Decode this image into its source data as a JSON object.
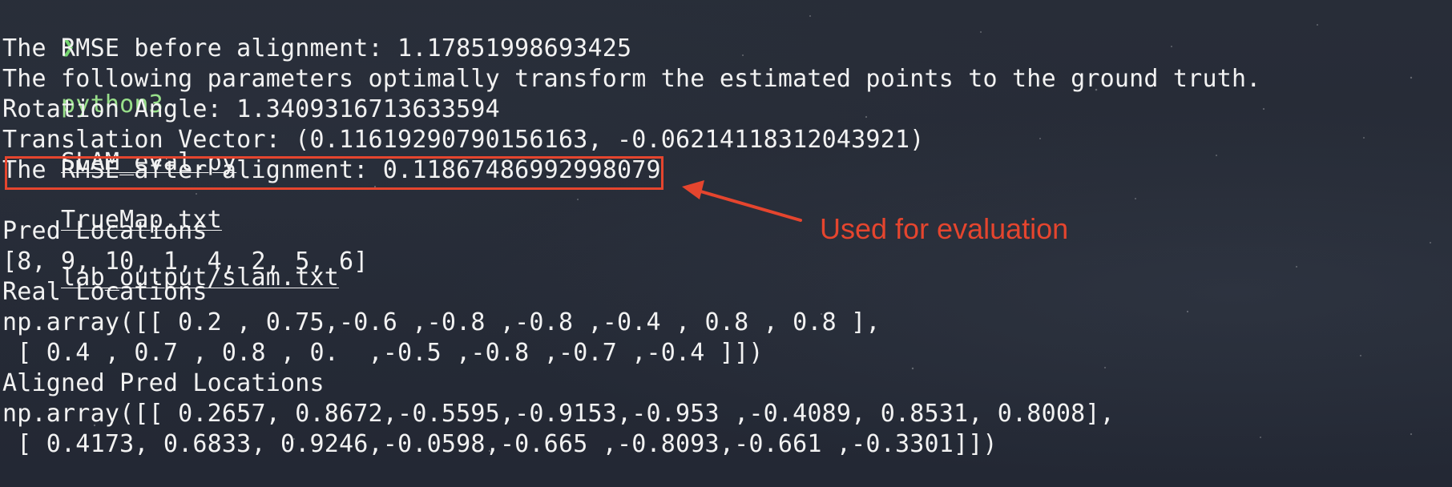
{
  "terminal": {
    "prompt": {
      "symbol": "❯",
      "command": "python3",
      "args": [
        "SLAM_eval.py",
        "TrueMap.txt",
        "lab_output/slam.txt"
      ]
    },
    "lines": [
      "The RMSE before alignment: 1.17851998693425",
      "The following parameters optimally transform the estimated points to the ground truth.",
      "Rotation Angle: 1.3409316713633594",
      "Translation Vector: (0.11619290790156163, -0.06214118312043921)",
      "The RMSE after alignment: 0.11867486992998079",
      "",
      "Pred Locations",
      "[8, 9, 10, 1, 4, 2, 5, 6]",
      "Real Locations",
      "np.array([[ 0.2 , 0.75,-0.6 ,-0.8 ,-0.8 ,-0.4 , 0.8 , 0.8 ],",
      " [ 0.4 , 0.7 , 0.8 , 0.  ,-0.5 ,-0.8 ,-0.7 ,-0.4 ]])",
      "Aligned Pred Locations",
      "np.array([[ 0.2657, 0.8672,-0.5595,-0.9153,-0.953 ,-0.4089, 0.8531, 0.8008],",
      " [ 0.4173, 0.6833, 0.9246,-0.0598,-0.665 ,-0.8093,-0.661 ,-0.3301]])"
    ]
  },
  "annotation": {
    "text": "Used for evaluation",
    "color": "#e5452e"
  },
  "colors": {
    "background": "#252a35",
    "text": "#f2f2f2",
    "prompt_green": "#74d46f",
    "accent_red": "#e5452e"
  }
}
